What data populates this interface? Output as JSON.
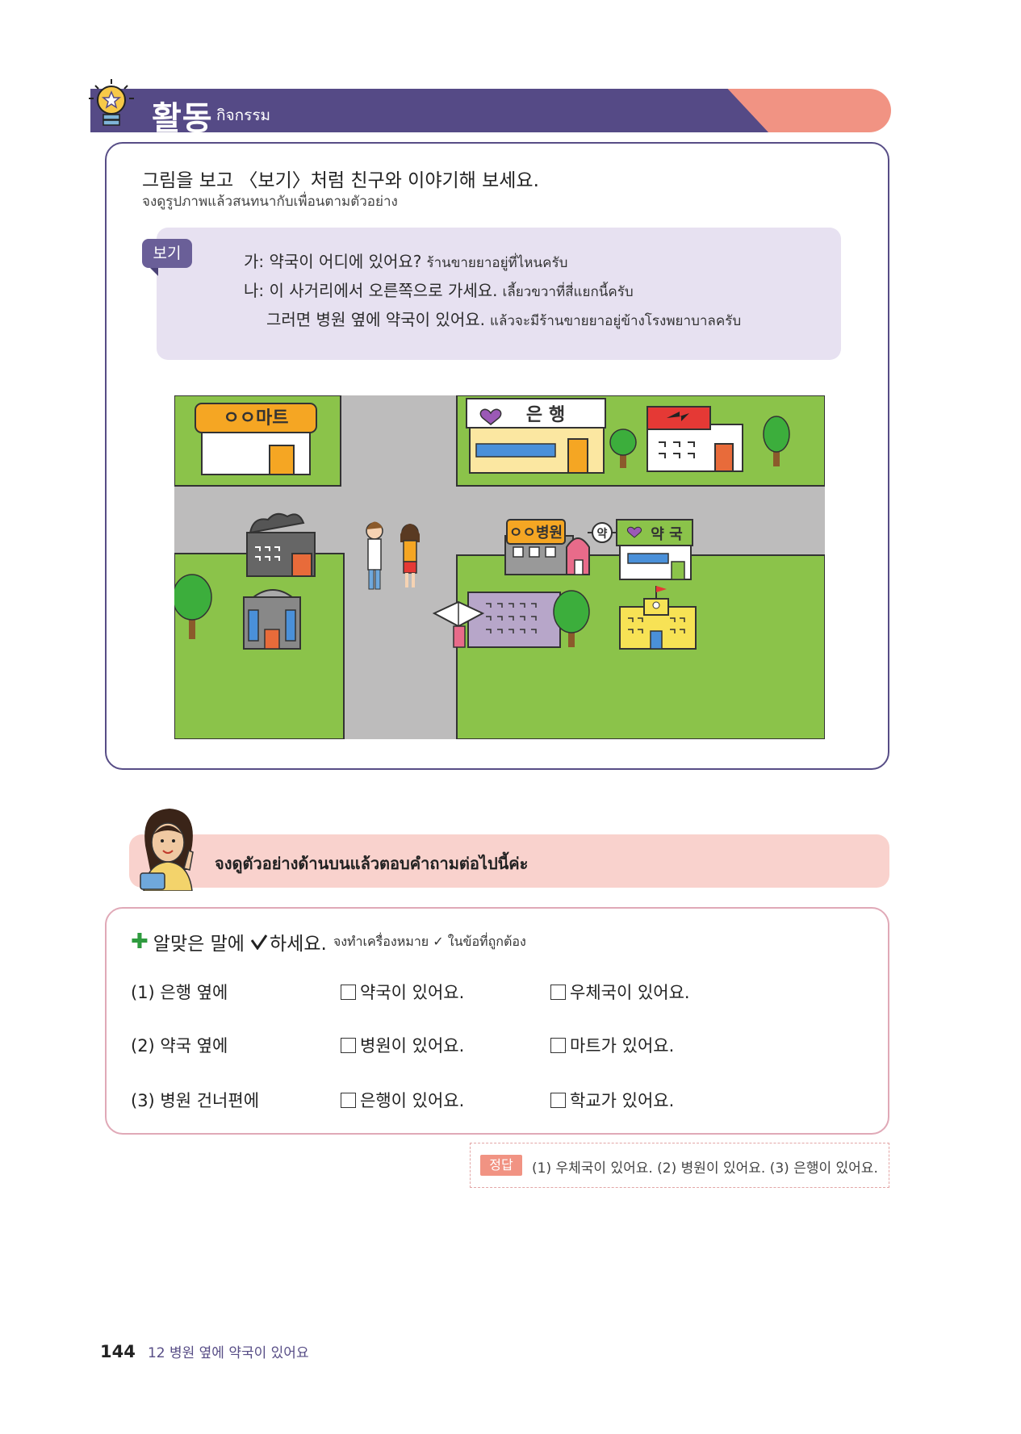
{
  "activity": {
    "title": "활동",
    "subtitle": "กิจกรรม"
  },
  "exercise": {
    "instruction": "그림을 보고 〈보기〉처럼 친구와 이야기해 보세요.",
    "instruction_th": "จงดูรูปภาพแล้วสนทนากับเพื่อนตามตัวอย่าง",
    "example_tag": "보기",
    "lines": [
      {
        "ko": "가: 약국이 어디에 있어요?",
        "th": "ร้านขายยาอยู่ที่ไหนครับ"
      },
      {
        "ko": "나: 이 사거리에서 오른쪽으로 가세요.",
        "th": "เลี้ยวขวาที่สี่แยกนี้ครับ"
      },
      {
        "ko": "그러면 병원 옆에 약국이 있어요.",
        "th": "แล้วจะมีร้านขายยาอยู่ข้างโรงพยาบาลครับ"
      }
    ]
  },
  "map": {
    "mart_sign": "ㅇㅇ마트",
    "bank_sign": "은 행",
    "hospital_sign": "ㅇㅇ병원",
    "pharmacy_badge": "약",
    "pharmacy_sign": "약 국"
  },
  "tip": {
    "text": "จงดูตัวอย่างด้านบนแล้วตอบคำถามต่อไปนี้ค่ะ"
  },
  "quiz": {
    "instruction_before": "알맞은 말에",
    "instruction_after": "하세요.",
    "instruction_th": "จงทำเครื่องหมาย ✓ ในข้อที่ถูกต้อง",
    "rows": [
      {
        "label": "(1) 은행 옆에",
        "option_a": "약국이 있어요.",
        "option_b": "우체국이 있어요."
      },
      {
        "label": "(2) 약국 옆에",
        "option_a": "병원이 있어요.",
        "option_b": "마트가 있어요."
      },
      {
        "label": "(3) 병원 건너편에",
        "option_a": "은행이 있어요.",
        "option_b": "학교가 있어요."
      }
    ]
  },
  "answer": {
    "tag": "정답",
    "text": "(1) 우체국이 있어요. (2) 병원이 있어요. (3) 은행이 있어요."
  },
  "footer": {
    "page_number": "144",
    "chapter": "12 병원 옆에 약국이 있어요"
  },
  "colors": {
    "header_purple": "#554a86",
    "header_salmon": "#f19383",
    "example_bg": "#e7e1f1",
    "tip_bg": "#f9d2cd",
    "check_green": "#2e9b3e"
  }
}
